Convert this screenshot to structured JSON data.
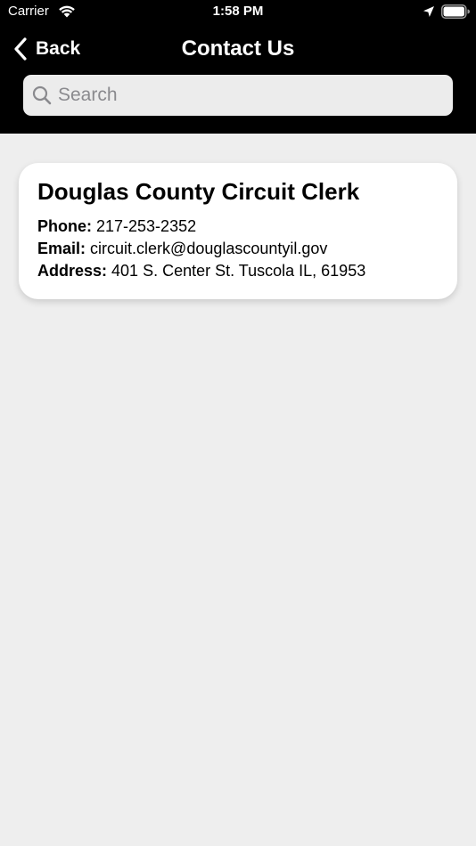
{
  "status_bar": {
    "carrier": "Carrier",
    "time": "1:58 PM",
    "icons": [
      "wifi-icon",
      "location-arrow-icon",
      "battery-icon"
    ]
  },
  "nav": {
    "back_label": "Back",
    "title": "Contact Us"
  },
  "search": {
    "placeholder": "Search",
    "value": ""
  },
  "contacts": [
    {
      "name": "Douglas County Circuit Clerk",
      "phone_label": "Phone:",
      "phone": "217-253-2352",
      "email_label": "Email:",
      "email": "circuit.clerk@douglascountyil.gov",
      "address_label": "Address:",
      "address": "401 S. Center St. Tuscola IL, 61953"
    }
  ],
  "colors": {
    "header_bg": "#000000",
    "page_bg": "#eeeeee",
    "card_bg": "#ffffff",
    "search_bg": "#ececec",
    "placeholder": "#8a8a8e"
  }
}
